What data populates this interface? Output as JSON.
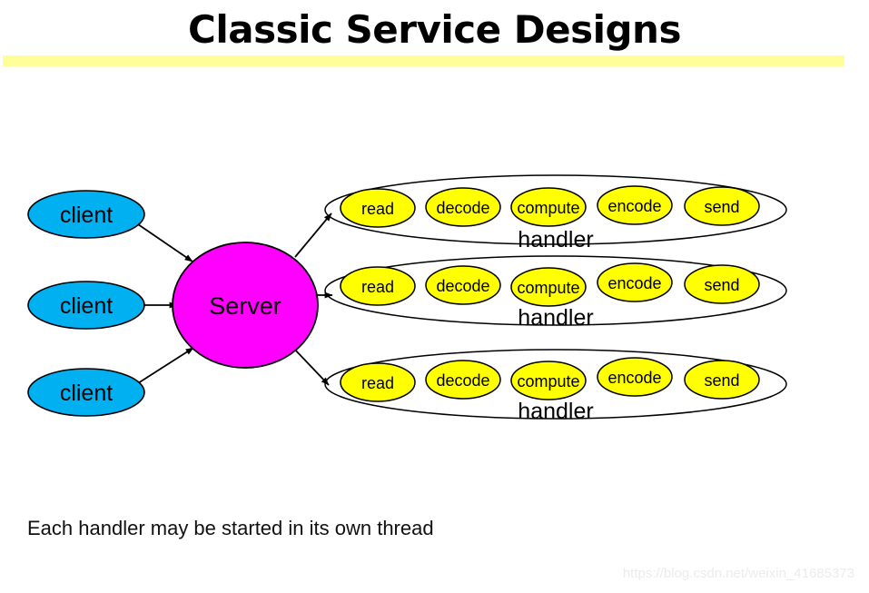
{
  "slide": {
    "title": "Classic Service Designs",
    "accent_rule_color": "#FFFF99",
    "caption": "Each handler may be started in its own thread",
    "watermark": "https://blog.csdn.net/weixin_41685373"
  },
  "colors": {
    "client_fill": "#00B0F0",
    "server_fill": "#FF00FF",
    "stage_fill": "#FFFF00",
    "outline": "#000000",
    "handler_outline": "#000000",
    "watermark_text": "#ececec"
  },
  "diagram": {
    "clients": [
      {
        "label": "client"
      },
      {
        "label": "client"
      },
      {
        "label": "client"
      }
    ],
    "server": {
      "label": "Server"
    },
    "handlers": [
      {
        "label": "handler",
        "stages": [
          {
            "label": "read"
          },
          {
            "label": "decode"
          },
          {
            "label": "compute"
          },
          {
            "label": "encode"
          },
          {
            "label": "send"
          }
        ]
      },
      {
        "label": "handler",
        "stages": [
          {
            "label": "read"
          },
          {
            "label": "decode"
          },
          {
            "label": "compute"
          },
          {
            "label": "encode"
          },
          {
            "label": "send"
          }
        ]
      },
      {
        "label": "handler",
        "stages": [
          {
            "label": "read"
          },
          {
            "label": "decode"
          },
          {
            "label": "compute"
          },
          {
            "label": "encode"
          },
          {
            "label": "send"
          }
        ]
      }
    ]
  }
}
